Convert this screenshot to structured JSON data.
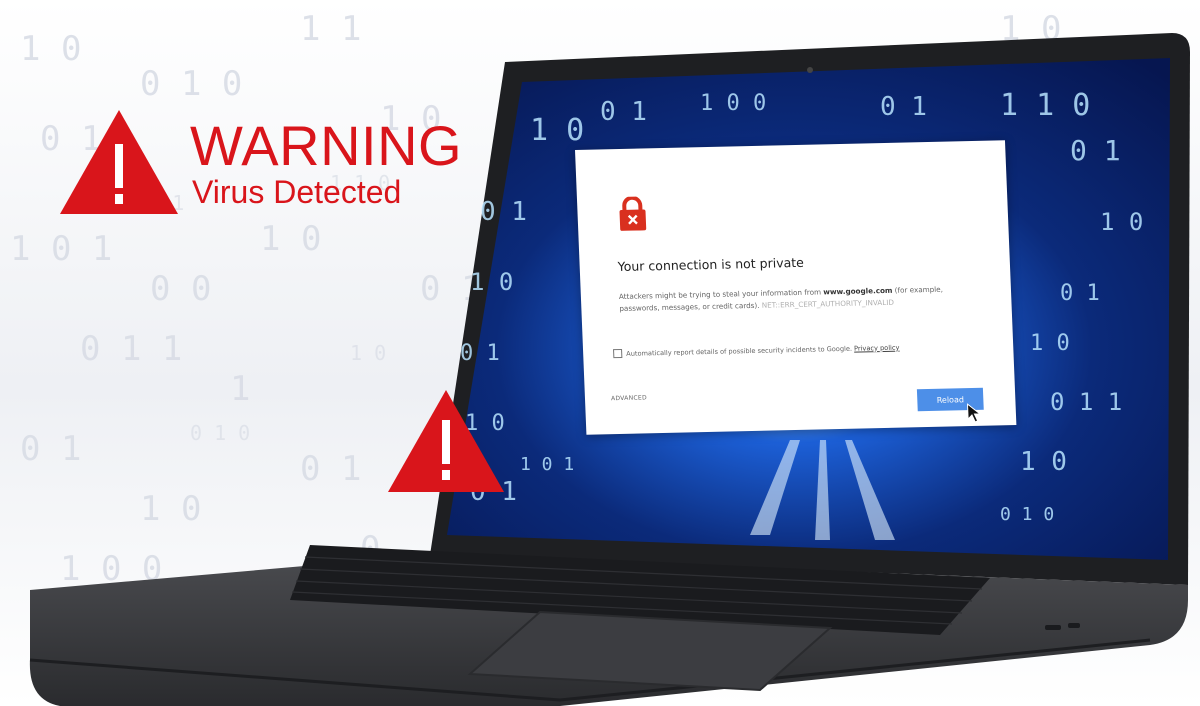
{
  "banner": {
    "title": "WARNING",
    "subtitle": "Virus Detected",
    "icon": "warning-triangle-icon",
    "color": "#d9151b"
  },
  "screen": {
    "background": "blue-binary-tunnel",
    "dialog": {
      "icon": "lock-error-icon",
      "title": "Your connection is not private",
      "body_prefix": "Attackers might be trying to steal your information from ",
      "domain": "www.google.com",
      "body_suffix": " (for example, passwords, messages, or credit cards). ",
      "error_code": "NET::ERR_CERT_AUTHORITY_INVALID",
      "report_label": "Automatically report details of possible security incidents to Google.",
      "report_checked": false,
      "privacy_link": "Privacy policy",
      "advanced_label": "ADVANCED",
      "reload_label": "Reload",
      "reload_color": "#4d8fe8"
    }
  },
  "colors": {
    "warning_red": "#d9151b",
    "laptop_body": "#3a3b3e",
    "screen_blue": "#0b2a7a"
  }
}
